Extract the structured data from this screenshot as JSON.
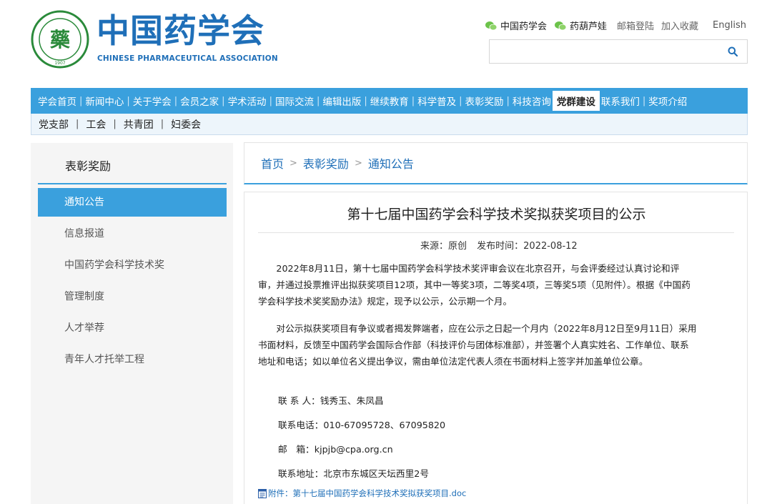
{
  "header": {
    "logo_cn": "中国药学会",
    "logo_en": "CHINESE PHARMACEUTICAL ASSOCIATION",
    "emblem_char": "藥",
    "emblem_year": "1907",
    "emblem_top": "中国药学会",
    "top_links": {
      "wechat1": "中国药学会",
      "wechat2": "药葫芦娃",
      "mail_login": "邮箱登陆",
      "favorite": "加入收藏",
      "english": "English"
    },
    "search": {
      "placeholder": ""
    }
  },
  "nav": {
    "items": [
      "学会首页",
      "新闻中心",
      "关于学会",
      "会员之家",
      "学术活动",
      "国际交流",
      "编辑出版",
      "继续教育",
      "科学普及",
      "表彰奖励",
      "科技咨询",
      "党群建设",
      "联系我们",
      "奖项介绍"
    ],
    "active": "党群建设"
  },
  "subnav": {
    "items": [
      "党支部",
      "工会",
      "共青团",
      "妇委会"
    ]
  },
  "sidebar": {
    "title": "表彰奖励",
    "items": [
      "通知公告",
      "信息报道",
      "中国药学会科学技术奖",
      "管理制度",
      "人才举荐",
      "青年人才托举工程"
    ]
  },
  "breadcrumb": {
    "home": "首页",
    "section": "表彰奖励",
    "current": "通知公告",
    "sep": ">"
  },
  "article": {
    "title": "第十七届中国药学会科学技术奖拟获奖项目的公示",
    "source": "来源：原创",
    "date": "发布时间：2022-08-12",
    "paragraph1": "2022年8月11日，第十七届中国药学会科学技术奖评审会议在北京召开，与会评委经过认真讨论和评审，并通过投票推评出拟获奖项目12项，其中一等奖3项，二等奖4项，三等奖5项（见附件）。根据《中国药学会科学技术奖奖励办法》规定，现予以公示，公示期一个月。",
    "paragraph2": "对公示拟获奖项目有争议或者揭发弊端者，应在公示之日起一个月内（2022年8月12日至9月11日）采用书面材料，反馈至中国药学会国际合作部（科技评价与团体标准部），并签署个人真实姓名、工作单位、联系地址和电话；如以单位名义提出争议，需由单位法定代表人须在书面材料上签字并加盖单位公章。",
    "contact_person": "联 系 人：钱秀玉、朱凤昌",
    "contact_phone": "联系电话：010-67095728、67095820",
    "contact_email": "邮　箱：kjpjb@cpa.org.cn",
    "contact_address": "联系地址：北京市东城区天坛西里2号",
    "attachment": "附件：第十七届中国药学会科学技术奖拟获奖项目.doc"
  },
  "colors": {
    "brand": "#1f6fb8",
    "nav": "#3aa0dd",
    "wechat": "#6cc34a"
  }
}
